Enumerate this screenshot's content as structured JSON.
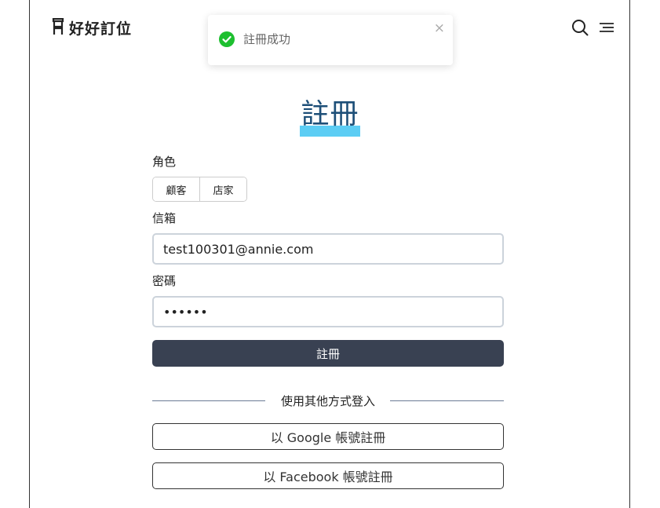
{
  "app": {
    "brand": "好好訂位"
  },
  "toast": {
    "message": "註冊成功",
    "close": "×"
  },
  "form": {
    "title": "註冊",
    "role_label": "角色",
    "roles": [
      "顧客",
      "店家"
    ],
    "email_label": "信箱",
    "email_value": "test100301@annie.com",
    "password_label": "密碼",
    "password_value": "••••••",
    "submit_label": "註冊"
  },
  "alt_login": {
    "divider_text": "使用其他方式登入",
    "google_label": "以 Google 帳號註冊",
    "facebook_label": "以 Facebook 帳號註冊"
  },
  "icons": {
    "logo": "chair-icon",
    "search": "search-icon",
    "menu": "menu-icon",
    "success": "check-circle-icon"
  },
  "colors": {
    "title": "#1d4f78",
    "title_highlight": "#5ccdf4",
    "submit_bg": "#394152",
    "success": "#1dbf2f"
  }
}
